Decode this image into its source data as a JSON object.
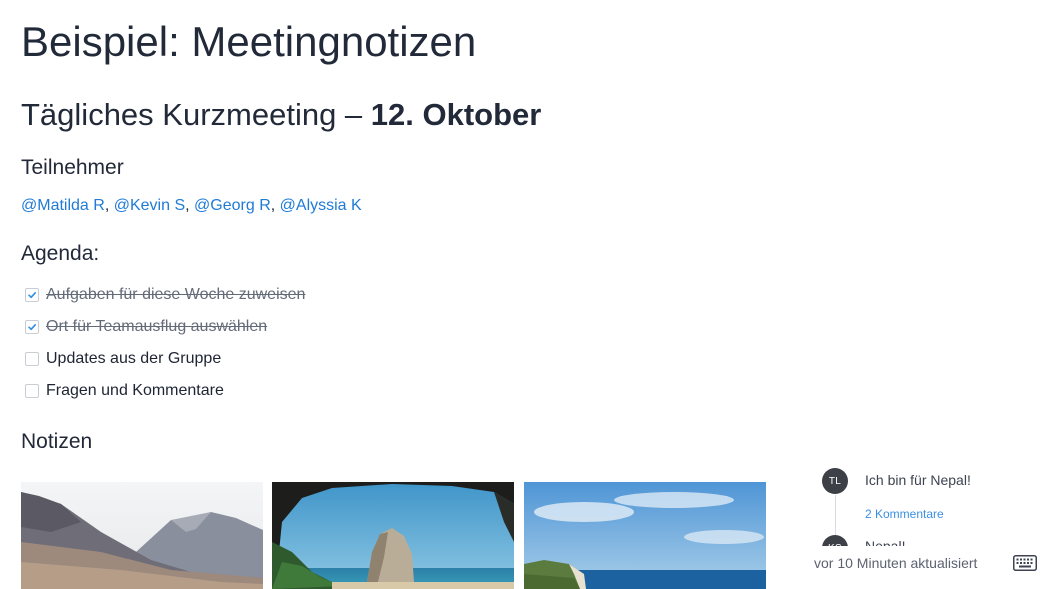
{
  "title": "Beispiel: Meetingnotizen",
  "subtitle": {
    "prefix": "Tägliches Kurzmeeting – ",
    "date": "12. Oktober"
  },
  "participants": {
    "heading": "Teilnehmer",
    "people": [
      "@Matilda R",
      "@Kevin S",
      "@Georg R",
      "@Alyssia K"
    ],
    "separator": ","
  },
  "agenda": {
    "heading": "Agenda:",
    "items": [
      {
        "label": "Aufgaben für diese Woche zuweisen",
        "checked": true
      },
      {
        "label": "Ort für Teamausflug auswählen",
        "checked": true
      },
      {
        "label": "Updates aus der Gruppe",
        "checked": false
      },
      {
        "label": "Fragen und Kommentare",
        "checked": false
      }
    ]
  },
  "notes": {
    "heading": "Notizen"
  },
  "images": [
    {
      "name": "mountain-photo",
      "subject": "mountains"
    },
    {
      "name": "sea-cave-photo",
      "subject": "sea cave with rock"
    },
    {
      "name": "coast-photo",
      "subject": "coastal cliffs"
    }
  ],
  "comments": [
    {
      "initials": "TL",
      "text": "Ich bin für Nepal!",
      "count_label": "2 Kommentare"
    },
    {
      "initials": "KS",
      "text": "Nepal!"
    }
  ],
  "status": {
    "text": "vor 10 Minuten aktualisiert",
    "keyboard_icon": "keyboard-icon"
  },
  "colors": {
    "link": "#1f7bd6",
    "check": "#2f8fe3",
    "avatar": "#3d4046"
  }
}
